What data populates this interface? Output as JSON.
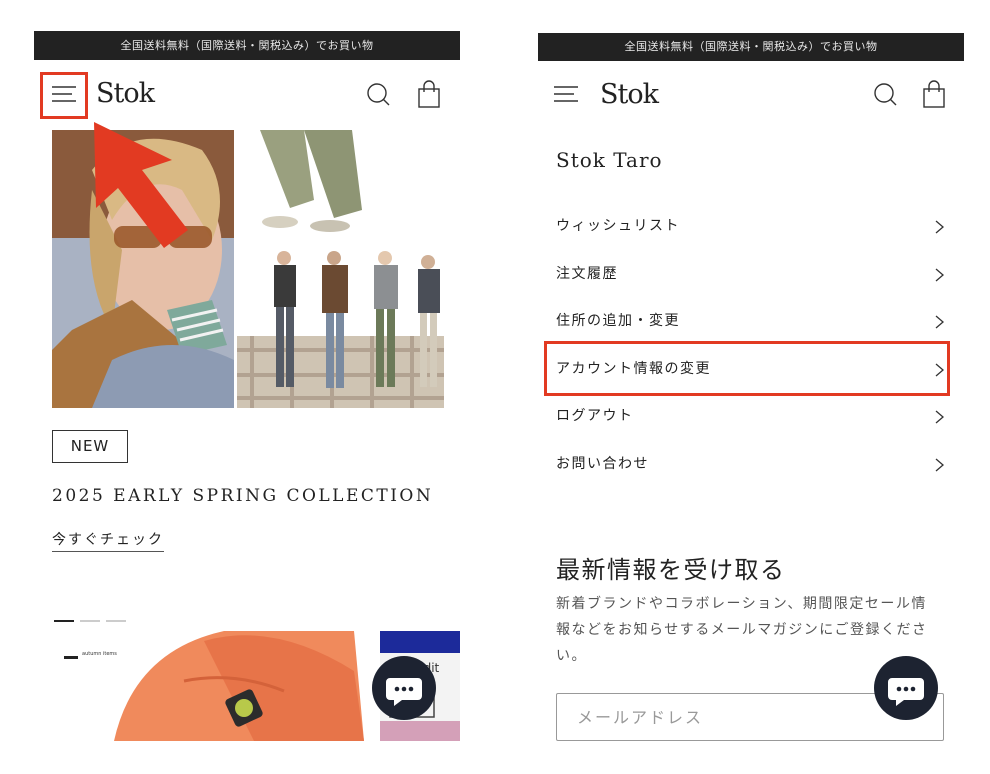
{
  "left": {
    "banner": "全国送料無料（国際送料・関税込み）でお買い物",
    "logo": "Stok",
    "new_badge": "NEW",
    "collection_title": "2025 EARLY SPRING COLLECTION",
    "check_link": "今すぐチェック",
    "promo_label": "autumn items",
    "promo_edit_text": "Edit"
  },
  "right": {
    "banner": "全国送料無料（国際送料・関税込み）でお買い物",
    "logo": "Stok",
    "user_name": "Stok Taro",
    "menu_items": [
      {
        "label": "ウィッシュリスト"
      },
      {
        "label": "注文履歴"
      },
      {
        "label": "住所の追加・変更"
      },
      {
        "label": "アカウント情報の変更"
      },
      {
        "label": "ログアウト"
      },
      {
        "label": "お問い合わせ"
      }
    ],
    "news_title": "最新情報を受け取る",
    "news_desc": "新着ブランドやコラボレーション、期間限定セール情報などをお知らせするメールマガジンにご登録ください。",
    "email_placeholder": "メールアドレス"
  },
  "colors": {
    "accent_red": "#e23a22",
    "banner_bg": "#222222",
    "chat_bg": "#1d2331"
  },
  "icons": [
    "menu-icon",
    "search-icon",
    "cart-icon",
    "chevron-right-icon",
    "chat-icon",
    "arrow-icon"
  ]
}
